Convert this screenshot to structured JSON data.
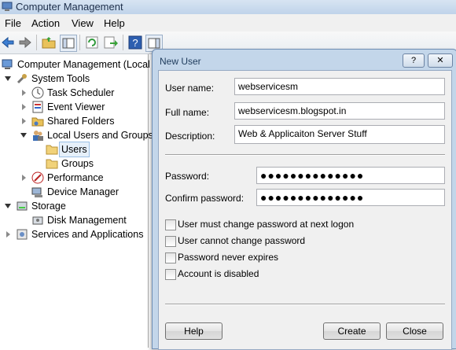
{
  "window": {
    "title": "Computer Management"
  },
  "menu": [
    "File",
    "Action",
    "View",
    "Help"
  ],
  "tree": {
    "items": [
      {
        "label": "Computer Management (Local"
      },
      {
        "label": "System Tools"
      },
      {
        "label": "Task Scheduler"
      },
      {
        "label": "Event Viewer"
      },
      {
        "label": "Shared Folders"
      },
      {
        "label": "Local Users and Groups"
      },
      {
        "label": "Users"
      },
      {
        "label": "Groups"
      },
      {
        "label": "Performance"
      },
      {
        "label": "Device Manager"
      },
      {
        "label": "Storage"
      },
      {
        "label": "Disk Management"
      },
      {
        "label": "Services and Applications"
      }
    ]
  },
  "dialog": {
    "title": "New User",
    "help_glyph": "?",
    "close_glyph": "✕",
    "username_label": "User name:",
    "username_value": "webservicesm",
    "fullname_label": "Full name:",
    "fullname_value": "webservicesm.blogspot.in",
    "description_label": "Description:",
    "description_value": "Web & Applicaiton Server Stuff",
    "password_label": "Password:",
    "password_mask": "●●●●●●●●●●●●●●",
    "confirm_label": "Confirm password:",
    "confirm_mask": "●●●●●●●●●●●●●●",
    "checkboxes": [
      {
        "label": "User must change password at next logon",
        "checked": false
      },
      {
        "label": "User cannot change password",
        "checked": false
      },
      {
        "label": "Password never expires",
        "checked": false
      },
      {
        "label": "Account is disabled",
        "checked": false
      }
    ],
    "help_button": "Help",
    "create_button": "Create",
    "close_button": "Close"
  }
}
